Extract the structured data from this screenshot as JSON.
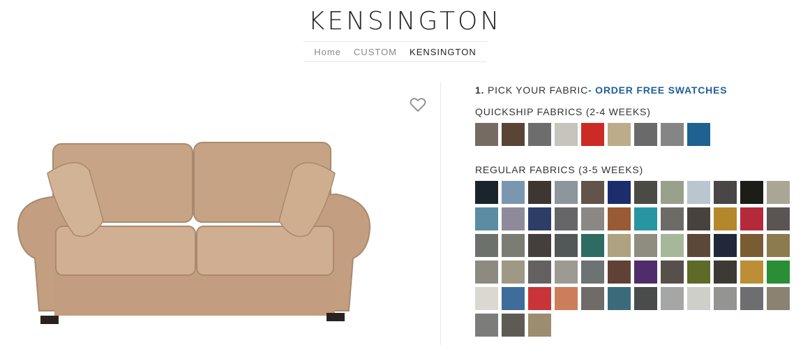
{
  "page": {
    "title": "KENSINGTON"
  },
  "breadcrumb": [
    {
      "label": "Home"
    },
    {
      "label": "CUSTOM"
    },
    {
      "label": "KENSINGTON"
    }
  ],
  "fabric_picker": {
    "step_number": "1.",
    "step_label": "PICK YOUR FABRIC",
    "swatch_link": "- ORDER FREE SWATCHES",
    "quickship_title": "QUICKSHIP FABRICS (2-4 WEEKS)",
    "regular_title": "REGULAR FABRICS (3-5 WEEKS)",
    "quickship_colors": [
      "#756b62",
      "#5a4436",
      "#6d6d6d",
      "#c7c3bd",
      "#cc2a25",
      "#bcac8a",
      "#6a6a6a",
      "#858585",
      "#1d6290"
    ],
    "regular_colors": [
      "#1b232c",
      "#7b97b0",
      "#3e3630",
      "#8d959d",
      "#62544a",
      "#1c2d6d",
      "#4b4b45",
      "#99a08b",
      "#b9c5cf",
      "#4a4645",
      "#1c1c18",
      "#a9a696",
      "#5b8ca4",
      "#8f8a9b",
      "#2c3d66",
      "#666668",
      "#8b8784",
      "#9a5a34",
      "#2896a2",
      "#6c6b67",
      "#48423f",
      "#b5872c",
      "#b52a3a",
      "#5a5552",
      "#6c716b",
      "#7b7c74",
      "#443f3c",
      "#525858",
      "#2e6b62",
      "#aea280",
      "#8f8c80",
      "#a7b79a",
      "#5d4739",
      "#20283a",
      "#7a5c33",
      "#8b7b4e",
      "#8d8a80",
      "#9e9884",
      "#646160",
      "#9c9a92",
      "#6d7272",
      "#614036",
      "#512c6a",
      "#57504a",
      "#5d6a28",
      "#3c3a34",
      "#bc8e35",
      "#2a8e37",
      "#dbd8d2",
      "#3f6d9b",
      "#c93438",
      "#cc7d59",
      "#6f6b69",
      "#3b6b7a",
      "#4a4b4b",
      "#a5a7a4",
      "#cfcfca",
      "#949593",
      "#6c6e70",
      "#8c8272",
      "#7c7c7a",
      "#5e5b55",
      "#9c8c70"
    ]
  }
}
